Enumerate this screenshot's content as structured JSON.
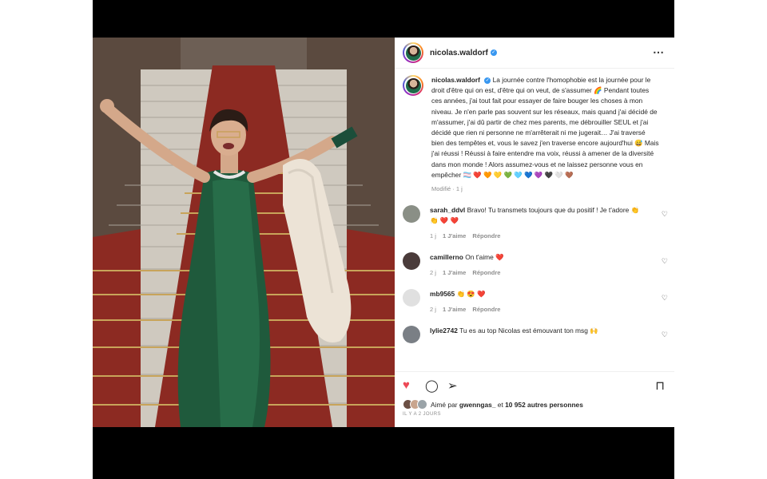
{
  "post": {
    "username": "nicolas.waldorf",
    "more_icon": "⋯"
  },
  "caption": {
    "username": "nicolas.waldorf",
    "text": "La journée contre l'homophobie est la journée pour le droit d'être qui on est, d'être qui on veut, de s'assumer 🌈 Pendant toutes ces années, j'ai tout fait pour essayer de faire bouger les choses à mon niveau. Je n'en parle pas souvent sur les réseaux, mais quand j'ai décidé de m'assumer, j'ai dû partir de chez mes parents, me débrouiller SEUL et j'ai décidé que rien ni personne ne m'arrêterait ni me jugerait… J'ai traversé bien des tempêtes et, vous le savez j'en traverse encore aujourd'hui 😅 Mais j'ai réussi ! Réussi à faire entendre ma voix, réussi à amener de la diversité dans mon monde ! Alors assumez-vous et ne laissez personne vous en empêcher 🏳️‍⚧️ ❤️ 🧡 💛 💚 🩵 💙 💜 🖤 🤍 🤎",
    "edited": "Modifié",
    "time": "1 j"
  },
  "comments": [
    {
      "username": "sarah_ddvl",
      "text": "Bravo! Tu transmets toujours que du positif ! Je t'adore 👏 👏 ❤️ ❤️",
      "time": "1 j",
      "likes": "1 J'aime",
      "reply": "Répondre",
      "avatar_color": "#8a8f86"
    },
    {
      "username": "camillerno",
      "text": "On t'aime ❤️",
      "time": "2 j",
      "likes": "1 J'aime",
      "reply": "Répondre",
      "avatar_color": "#4a3b3a"
    },
    {
      "username": "mb9565",
      "text": "👏 😍 ❤️",
      "time": "2 j",
      "likes": "1 J'aime",
      "reply": "Répondre",
      "avatar_color": "#e0e0e0"
    },
    {
      "username": "lylie2742",
      "text": "Tu es au top Nicolas est émouvant ton msg 🙌",
      "time": "",
      "likes": "",
      "reply": "",
      "avatar_color": "#7a7f85"
    }
  ],
  "likes": {
    "prefix": "Aimé par",
    "user": "gwenngas_",
    "middle": "et",
    "count": "10 952 autres personnes"
  },
  "date": "IL Y A 2 JOURS",
  "colors": {
    "like_red": "#ed4956",
    "verified_blue": "#3897f0",
    "meta_gray": "#8e8e8e"
  }
}
